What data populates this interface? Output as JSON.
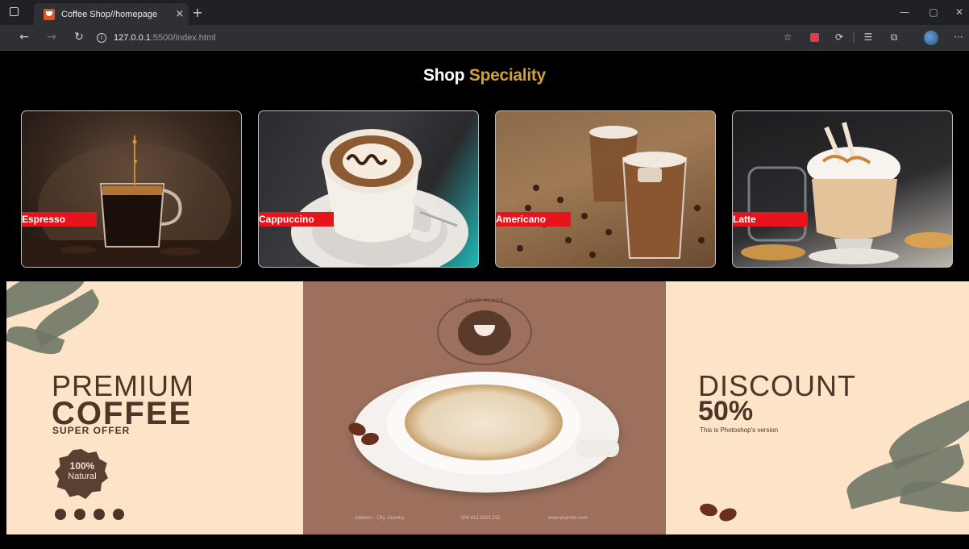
{
  "browser": {
    "tab_title": "Coffee Shop//homepage",
    "tab_close": "×",
    "new_tab": "+",
    "url_host": "127.0.0.1",
    "url_path": ":5500/index.html",
    "window_controls": {
      "minimize": "—",
      "maximize": "▢",
      "close": "✕"
    },
    "nav": {
      "back": "←",
      "forward": "→",
      "reload": "↻"
    },
    "toolbar_icons": [
      "favorite-add-icon",
      "extension-icon",
      "extensions-icon",
      "favorites-icon",
      "collections-icon",
      "profile-icon",
      "more-icon"
    ],
    "toolbar_glyphs": {
      "favorite": "☆",
      "ext": "⟳",
      "sep": "|",
      "favorites": "☰",
      "collections": "⧉",
      "more": "···"
    }
  },
  "page": {
    "heading_part1": "Shop",
    "heading_part2": "Speciality",
    "heading_accent": "#cfa03a",
    "label_color": "#e8141b",
    "cards": [
      {
        "label": "Espresso"
      },
      {
        "label": "Cappuccino"
      },
      {
        "label": "Americano"
      },
      {
        "label": "Latte"
      }
    ],
    "banner": {
      "premium": "PREMIUM",
      "coffee": "COFFEE",
      "super_offer": "SUPER OFFER",
      "seal_line1": "100%",
      "seal_line2": "Natural",
      "logo_text": "YOUR PLACE",
      "discount": "DISCOUNT",
      "percent": "50%",
      "note": "This is Photoshop's version",
      "footer_address": "Address - City, Country",
      "footer_phone": "004 412 4323 215",
      "footer_web": "www.yoursite.com",
      "background": "#fde3c7",
      "middle_color": "#9c705c"
    }
  }
}
